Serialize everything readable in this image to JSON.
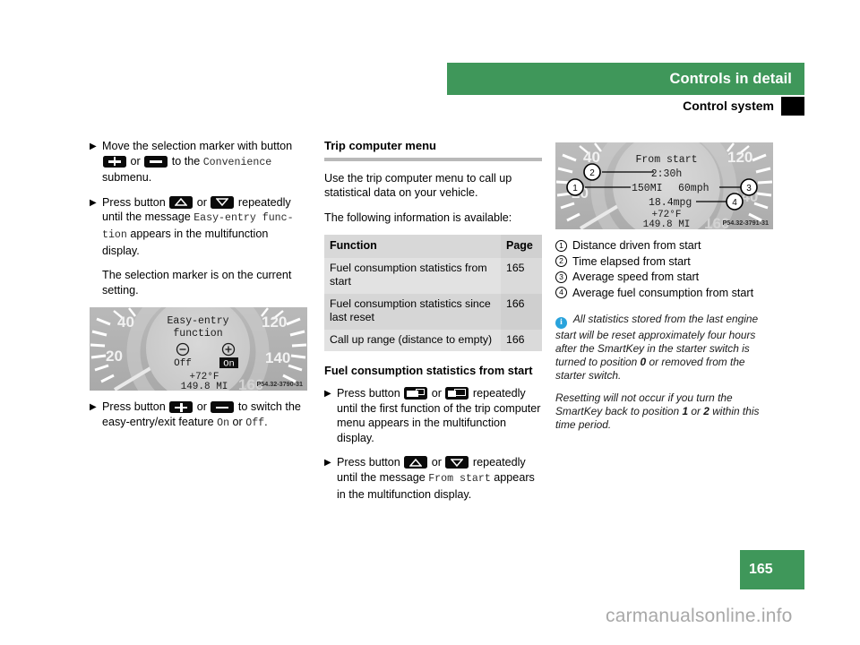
{
  "header": {
    "chapter_title": "Controls in detail",
    "section_title": "Control system",
    "tab_marker_icon": "black-tab-marker"
  },
  "footer": {
    "page_number": "165",
    "watermark": "carmanualsonline.info"
  },
  "left_column": {
    "bullet_1": {
      "text_a": "Move the selection marker with button",
      "icon_1": "plus-button-icon",
      "text_b": "or",
      "icon_2": "minus-button-icon",
      "text_c": "to the",
      "mono": "Convenience",
      "text_d": "submenu."
    },
    "bullet_2": {
      "text_a": "Press button",
      "icon_1": "up-arrow-button-icon",
      "text_b": "or",
      "icon_2": "down-arrow-button-icon",
      "text_c": "repeatedly until the message",
      "mono": "Easy-entry func- tion",
      "text_d": "appears in the multifunction display."
    },
    "paragraph_1": "The selection marker is on the current setting.",
    "illustration": {
      "name": "speedometer-easy-entry-display",
      "gauge_left_labels": [
        "40",
        "20"
      ],
      "gauge_right_labels": [
        "120",
        "140",
        "160"
      ],
      "display_title_line1": "Easy-entry",
      "display_title_line2": "function",
      "option_minus_icon": "circled-minus-icon",
      "option_minus_label": "Off",
      "option_plus_icon": "circled-plus-icon",
      "option_plus_label": "On",
      "temperature": "+72°F",
      "odometer": "149.8 MI",
      "figure_code": "P54.32-3790-31"
    },
    "bullet_3": {
      "text_a": "Press button",
      "icon_1": "plus-button-icon",
      "text_b": "or",
      "icon_2": "minus-button-icon",
      "text_c": "to switch the easy-entry/exit feature",
      "mono_on": "On",
      "text_d": "or",
      "mono_off": "Off",
      "text_e": "."
    }
  },
  "middle_column": {
    "heading": "Trip computer menu",
    "paragraph_1": "Use the trip computer menu to call up statistical data on your vehicle.",
    "paragraph_2": "The following information is available:",
    "table": {
      "headers": [
        "Function",
        "Page"
      ],
      "rows": [
        {
          "function": "Fuel consumption statistics from start",
          "page": "165"
        },
        {
          "function": "Fuel consumption statistics since last reset",
          "page": "166"
        },
        {
          "function": "Call up range (distance to empty)",
          "page": "166"
        }
      ]
    },
    "subheading": "Fuel consumption statistics from start",
    "bullet_1": {
      "text_a": "Press button",
      "icon_1": "back-window-button-icon",
      "text_b": "or",
      "icon_2": "forward-window-button-icon",
      "text_c": "repeatedly until the first function of the trip computer menu appears in the multifunction display."
    },
    "bullet_2": {
      "text_a": "Press button",
      "icon_1": "up-arrow-button-icon",
      "text_b": "or",
      "icon_2": "down-arrow-button-icon",
      "text_c": "repeatedly until the message",
      "mono": "From start",
      "text_d": "appears in the multifunction display."
    }
  },
  "right_column": {
    "illustration": {
      "name": "speedometer-trip-computer-display",
      "gauge_left_labels": [
        "40",
        "20"
      ],
      "gauge_right_labels": [
        "120",
        "140",
        "160"
      ],
      "display_title": "From start",
      "value_time": "2:30h",
      "value_distance": "150MI",
      "value_speed": "60mph",
      "value_consumption": "18.4mpg",
      "temperature": "+72°F",
      "odometer": "149.8 MI",
      "figure_code": "P54.32-3791-31",
      "callouts": [
        "1",
        "2",
        "3",
        "4"
      ]
    },
    "legend": [
      {
        "num": "1",
        "label": "Distance driven from start"
      },
      {
        "num": "2",
        "label": "Time elapsed from start"
      },
      {
        "num": "3",
        "label": "Average speed from start"
      },
      {
        "num": "4",
        "label": "Average fuel consumption from start"
      }
    ],
    "note": {
      "icon": "info-circle-icon",
      "paragraph_1_a": "All statistics stored from the last engine start will be reset approximately four hours after the SmartKey in the starter switch is turned to position",
      "paragraph_1_bold": "0",
      "paragraph_1_b": "or removed from the starter switch.",
      "paragraph_2_a": "Resetting will not occur if you turn the SmartKey back to position",
      "paragraph_2_bold1": "1",
      "paragraph_2_mid": "or",
      "paragraph_2_bold2": "2",
      "paragraph_2_b": "within this time period."
    }
  },
  "colors": {
    "brand_green": "#3f975a",
    "info_blue": "#29a3dc",
    "table_gray": "#d6d6d6"
  }
}
